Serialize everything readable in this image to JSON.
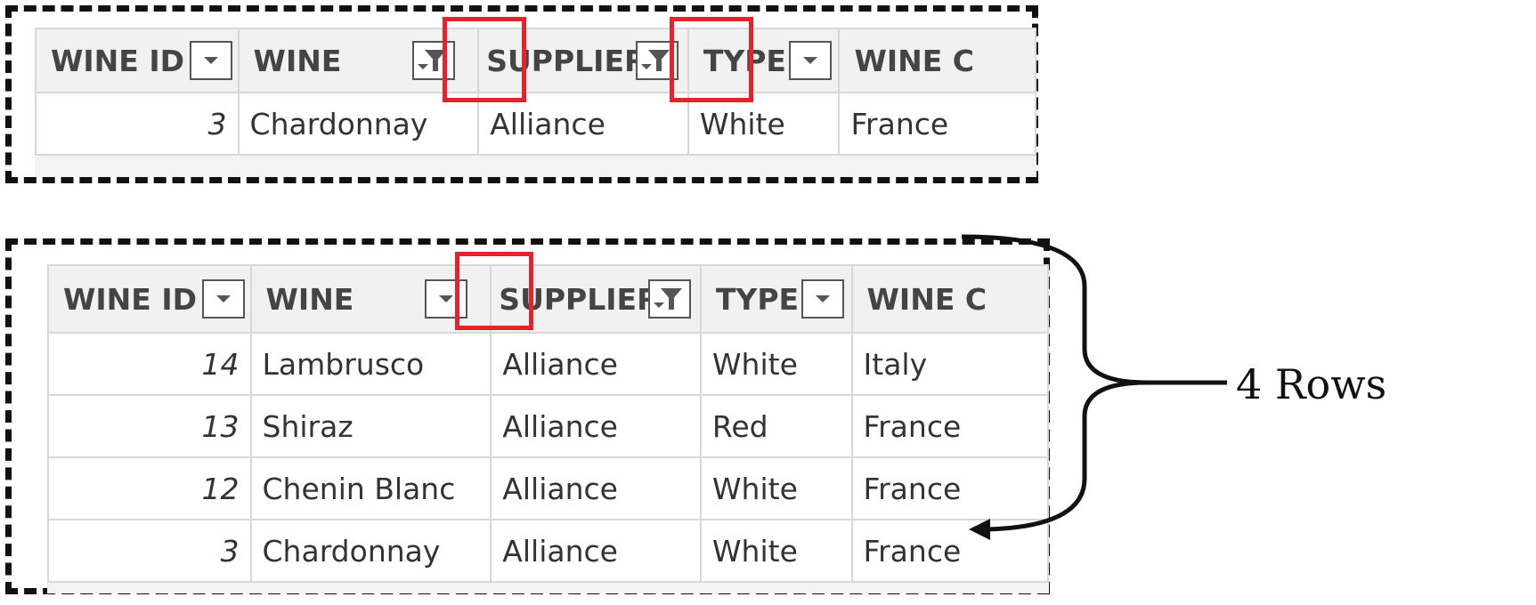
{
  "columns": {
    "wine_id": "WINE ID",
    "wine": "WINE",
    "supplier": "SUPPLIER",
    "type": "TYPE",
    "wine_country": "WINE C"
  },
  "top_table": {
    "rows": [
      {
        "id": "3",
        "wine": "Chardonnay",
        "supplier": "Alliance",
        "type": "White",
        "country": "France"
      }
    ]
  },
  "bottom_table": {
    "rows": [
      {
        "id": "14",
        "wine": "Lambrusco",
        "supplier": "Alliance",
        "type": "White",
        "country": "Italy"
      },
      {
        "id": "13",
        "wine": "Shiraz",
        "supplier": "Alliance",
        "type": "Red",
        "country": "France"
      },
      {
        "id": "12",
        "wine": "Chenin Blanc",
        "supplier": "Alliance",
        "type": "White",
        "country": "France"
      },
      {
        "id": "3",
        "wine": "Chardonnay",
        "supplier": "Alliance",
        "type": "White",
        "country": "France"
      }
    ]
  },
  "annotation": {
    "rows_label": "4 Rows",
    "highlight_color": "#e5232b"
  },
  "icons": {
    "dropdown": "chevron-down-icon",
    "filtered": "filter-icon"
  }
}
